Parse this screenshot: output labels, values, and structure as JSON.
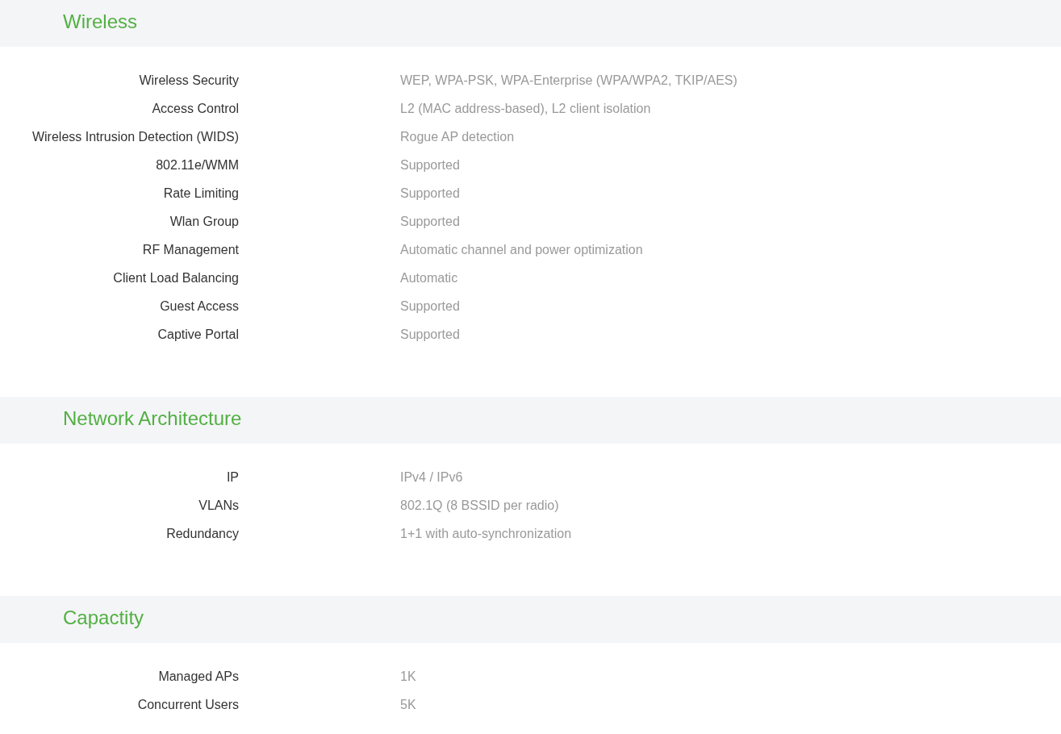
{
  "sections": [
    {
      "title": "Wireless",
      "rows": [
        {
          "label": "Wireless Security",
          "value": "WEP, WPA-PSK, WPA-Enterprise (WPA/WPA2, TKIP/AES)"
        },
        {
          "label": "Access Control",
          "value": "L2 (MAC address-based), L2 client isolation"
        },
        {
          "label": "Wireless Intrusion Detection (WIDS)",
          "value": "Rogue AP detection"
        },
        {
          "label": "802.11e/WMM",
          "value": "Supported"
        },
        {
          "label": "Rate Limiting",
          "value": "Supported"
        },
        {
          "label": "Wlan Group",
          "value": "Supported"
        },
        {
          "label": "RF Management",
          "value": "Automatic channel and power optimization"
        },
        {
          "label": "Client Load Balancing",
          "value": "Automatic"
        },
        {
          "label": "Guest Access",
          "value": "Supported"
        },
        {
          "label": "Captive Portal",
          "value": "Supported"
        }
      ]
    },
    {
      "title": "Network Architecture",
      "rows": [
        {
          "label": "IP",
          "value": "IPv4 / IPv6"
        },
        {
          "label": "VLANs",
          "value": "802.1Q (8 BSSID per radio)"
        },
        {
          "label": "Redundancy",
          "value": "1+1 with auto-synchronization"
        }
      ]
    },
    {
      "title": "Capactity",
      "rows": [
        {
          "label": "Managed APs",
          "value": "1K"
        },
        {
          "label": "Concurrent Users",
          "value": "5K"
        }
      ]
    }
  ]
}
